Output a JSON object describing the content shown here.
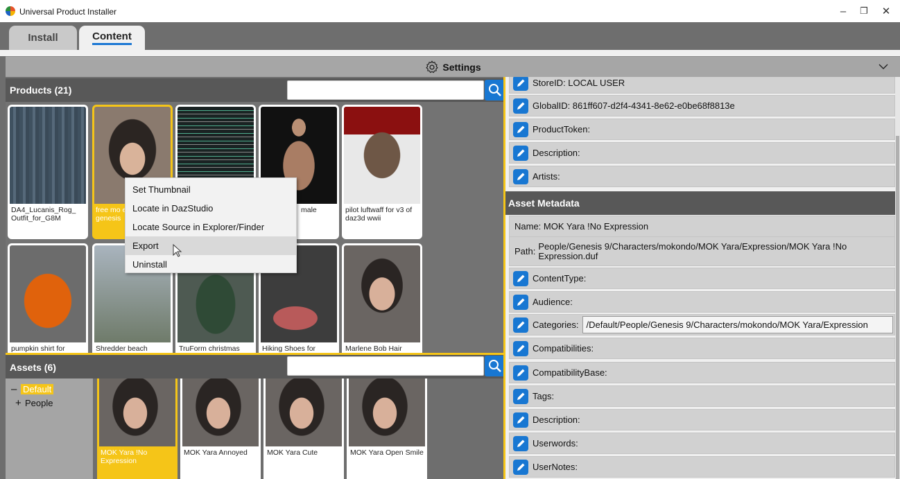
{
  "window": {
    "title": "Universal Product Installer",
    "minimize": "–",
    "restore": "❐",
    "close": "✕"
  },
  "tabs": [
    {
      "label": "Install"
    },
    {
      "label": "Content"
    }
  ],
  "settings": {
    "label": "Settings"
  },
  "products": {
    "header": "Products (21)",
    "search_placeholder": "",
    "items": [
      {
        "caption": "DA4_Lucanis_Rog_ Outfit_for_G8M",
        "thumb_color": "#4d5e6b"
      },
      {
        "caption": "free mo express genesis",
        "thumb_color": "#7a6a5e"
      },
      {
        "caption": "",
        "thumb_color": "#1e2a2a"
      },
      {
        "caption": "male",
        "thumb_color": "#1b1b1b"
      },
      {
        "caption": "pilot luftwaff for v3 of daz3d wwii",
        "thumb_color": "#b8b8b8"
      },
      {
        "caption": "pumpkin shirt for",
        "thumb_color": "#e26a12"
      },
      {
        "caption": "Shredder beach",
        "thumb_color": "#8c97a2"
      },
      {
        "caption": "TruForm christmas",
        "thumb_color": "#3a4a3a"
      },
      {
        "caption": "Hiking Shoes for",
        "thumb_color": "#4a4a4a"
      },
      {
        "caption": "Marlene Bob Hair",
        "thumb_color": "#5a5552"
      }
    ]
  },
  "context_menu": {
    "items": [
      "Set Thumbnail",
      "Locate in DazStudio",
      "Locate Source in Explorer/Finder",
      "Export",
      "Uninstall"
    ]
  },
  "assets": {
    "header": "Assets (6)",
    "search_placeholder": "",
    "tree": [
      {
        "symbol": "–",
        "label": "Default"
      },
      {
        "symbol": "+",
        "label": "People"
      }
    ],
    "items": [
      {
        "caption": "MOK Yara !No Expression"
      },
      {
        "caption": "MOK Yara Annoyed"
      },
      {
        "caption": "MOK Yara Cute"
      },
      {
        "caption": "MOK Yara Open Smile"
      }
    ]
  },
  "details": {
    "store_id": "StoreID:  LOCAL USER",
    "global_id": "GlobalID:  861ff607-d2f4-4341-8e62-e0be68f8813e",
    "product_token": "ProductToken:",
    "description": "Description:",
    "artists": "Artists:"
  },
  "asset_metadata": {
    "header": "Asset Metadata",
    "name": "Name:  MOK Yara !No Expression",
    "path_label": "Path:",
    "path_value": "People/Genesis 9/Characters/mokondo/MOK Yara/Expression/MOK Yara !No Expression.duf",
    "content_type": "ContentType:",
    "audience": "Audience:",
    "categories_label": "Categories:",
    "categories_value": "/Default/People/Genesis 9/Characters/mokondo/MOK Yara/Expression",
    "compatibilities": "Compatibilities:",
    "compatibility_base": "CompatibilityBase:",
    "tags": "Tags:",
    "description": "Description:",
    "userwords": "Userwords:",
    "usernotes": "UserNotes:"
  }
}
